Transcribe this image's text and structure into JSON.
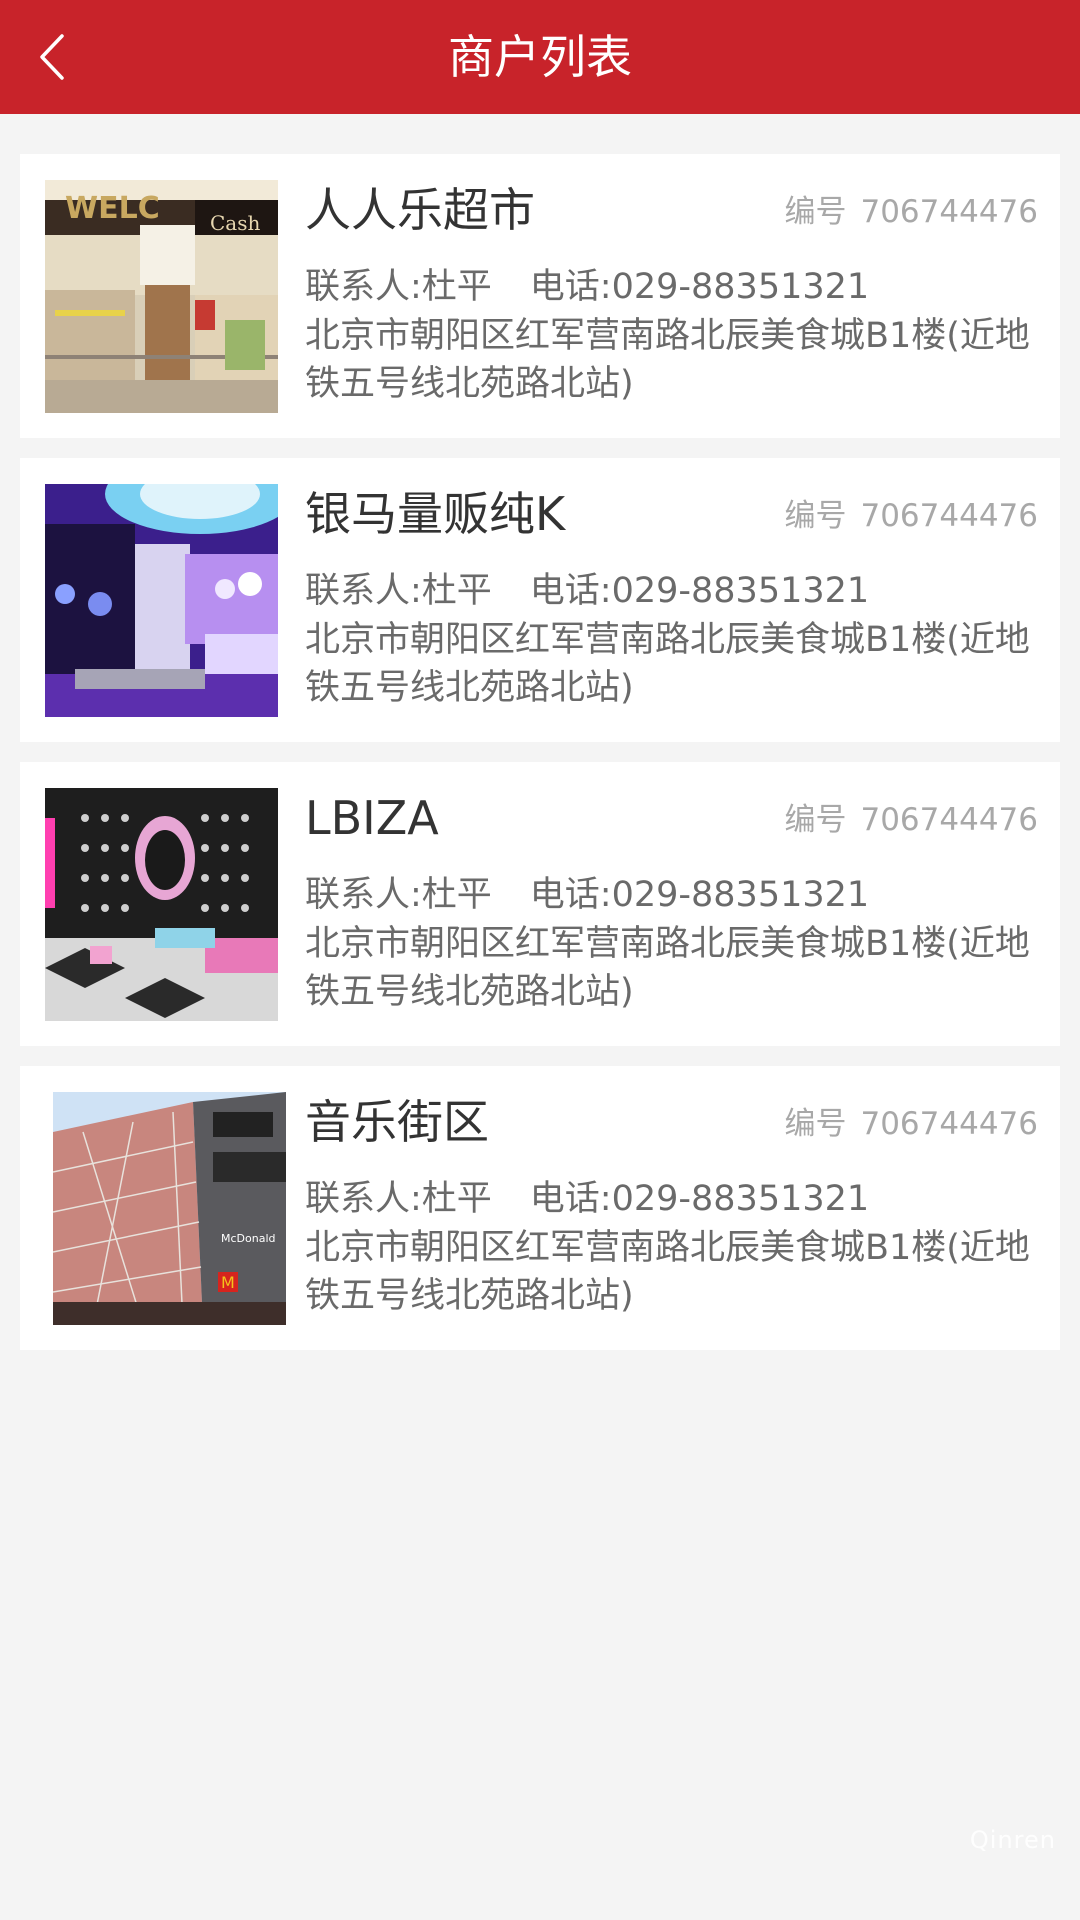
{
  "header": {
    "title": "商户列表",
    "back_icon": "chevron-left-icon",
    "background": "#c8232a"
  },
  "merchants": [
    {
      "name": "人人乐超市",
      "code_label": "编号",
      "code": "706744476",
      "contact": "联系人:杜平",
      "phone": "电话:029-88351321",
      "address": "北京市朝阳区红军营南路北辰美食城B1楼(近地铁五号线北苑路北站)",
      "image": "supermarket-photo"
    },
    {
      "name": "银马量贩纯K",
      "code_label": "编号",
      "code": "706744476",
      "contact": "联系人:杜平",
      "phone": "电话:029-88351321",
      "address": "北京市朝阳区红军营南路北辰美食城B1楼(近地铁五号线北苑路北站)",
      "image": "ktv-room-photo"
    },
    {
      "name": "LBIZA",
      "code_label": "编号",
      "code": "706744476",
      "contact": "联系人:杜平",
      "phone": "电话:029-88351321",
      "address": "北京市朝阳区红军营南路北辰美食城B1楼(近地铁五号线北苑路北站)",
      "image": "club-room-photo"
    },
    {
      "name": "音乐街区",
      "code_label": "编号",
      "code": "706744476",
      "contact": "联系人:杜平",
      "phone": "电话:029-88351321",
      "address": "北京市朝阳区红军营南路北辰美食城B1楼(近地铁五号线北苑路北站)",
      "image": "shopping-mall-photo"
    }
  ],
  "watermark": "Qinren"
}
